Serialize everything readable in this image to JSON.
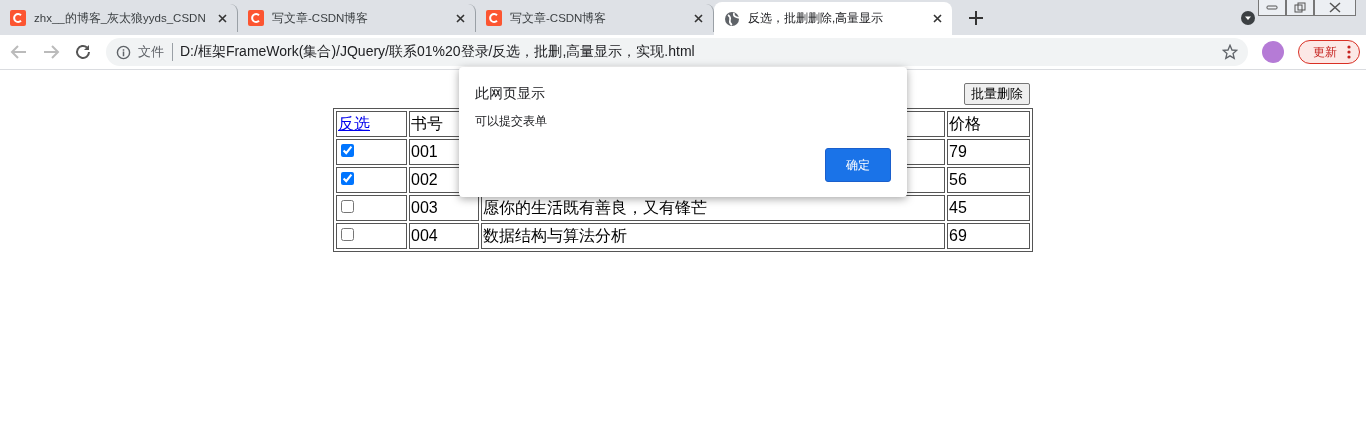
{
  "browser": {
    "tabs": [
      {
        "title": "zhx__的博客_灰太狼yyds_CSDN",
        "kind": "logo",
        "selected": false
      },
      {
        "title": "写文章-CSDN博客",
        "kind": "logo",
        "selected": false
      },
      {
        "title": "写文章-CSDN博客",
        "kind": "logo",
        "selected": false
      },
      {
        "title": "反选，批删删除,高量显示",
        "kind": "globe",
        "selected": true
      }
    ],
    "address": {
      "scheme_label": "文件",
      "url": "D:/框架FrameWork(集合)/JQuery/联系01%20登录/反选，批删,高量显示，实现.html"
    },
    "update_button": "更新"
  },
  "page": {
    "delete_button": "批量删除",
    "header": {
      "toggle_link": "反选",
      "id": "书号",
      "price": "价格"
    },
    "rows": [
      {
        "checked": true,
        "id": "001",
        "price": "79"
      },
      {
        "checked": true,
        "id": "002",
        "price": "56"
      },
      {
        "checked": false,
        "id": "003",
        "name": "愿你的生活既有善良，又有锋芒",
        "price": "45"
      },
      {
        "checked": false,
        "id": "004",
        "name": "数据结构与算法分析",
        "price": "69"
      }
    ]
  },
  "dialog": {
    "title": "此网页显示",
    "message": "可以提交表单",
    "ok_button": "确定"
  }
}
